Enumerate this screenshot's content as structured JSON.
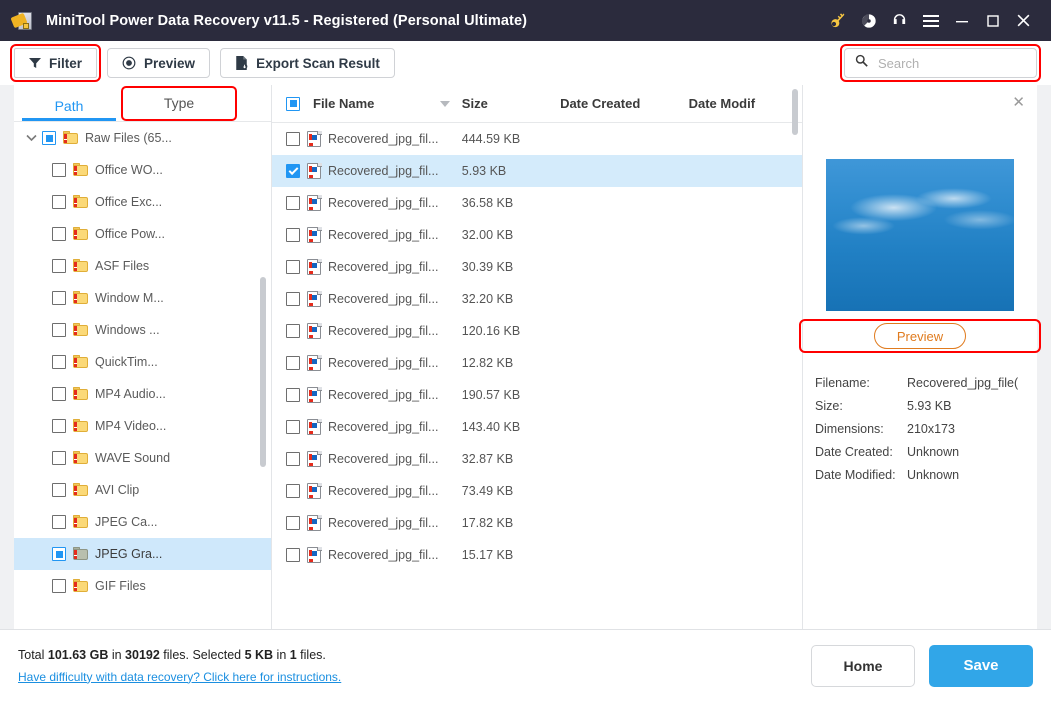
{
  "titlebar": {
    "title": "MiniTool Power Data Recovery v11.5 - Registered (Personal Ultimate)",
    "icons": [
      {
        "name": "key-icon",
        "label": "key"
      },
      {
        "name": "disc-icon",
        "label": "disc"
      },
      {
        "name": "headphones-icon",
        "label": "headphones"
      },
      {
        "name": "hamburger-menu-icon",
        "label": "menu"
      },
      {
        "name": "minimize-icon",
        "label": "minimize"
      },
      {
        "name": "maximize-icon",
        "label": "maximize"
      },
      {
        "name": "close-icon",
        "label": "close"
      }
    ]
  },
  "toolbar": {
    "filter_label": "Filter",
    "preview_label": "Preview",
    "export_label": "Export Scan Result"
  },
  "search": {
    "placeholder": "Search",
    "value": ""
  },
  "tabs": {
    "path_label": "Path",
    "type_label": "Type"
  },
  "tree": {
    "root": {
      "label": "Raw Files (65...",
      "check": "partial",
      "expanded": true
    },
    "items": [
      {
        "label": "Office WO...",
        "check": "none",
        "folder": "yellow"
      },
      {
        "label": "Office Exc...",
        "check": "none",
        "folder": "yellow"
      },
      {
        "label": "Office Pow...",
        "check": "none",
        "folder": "yellow"
      },
      {
        "label": "ASF Files",
        "check": "none",
        "folder": "yellow"
      },
      {
        "label": "Window M...",
        "check": "none",
        "folder": "yellow"
      },
      {
        "label": "Windows ...",
        "check": "none",
        "folder": "yellow"
      },
      {
        "label": "QuickTim...",
        "check": "none",
        "folder": "yellow"
      },
      {
        "label": "MP4 Audio...",
        "check": "none",
        "folder": "yellow"
      },
      {
        "label": "MP4 Video...",
        "check": "none",
        "folder": "yellow"
      },
      {
        "label": "WAVE Sound",
        "check": "none",
        "folder": "yellow"
      },
      {
        "label": "AVI Clip",
        "check": "none",
        "folder": "yellow"
      },
      {
        "label": "JPEG Ca...",
        "check": "none",
        "folder": "yellow"
      },
      {
        "label": "JPEG Gra...",
        "check": "partial",
        "folder": "gray",
        "selected": true
      },
      {
        "label": "GIF Files",
        "check": "none",
        "folder": "yellow"
      }
    ]
  },
  "filelist": {
    "columns": {
      "name": "File Name",
      "size": "Size",
      "date_created": "Date Created",
      "date_modified": "Date Modif"
    },
    "header_check": "partial",
    "rows": [
      {
        "name": "Recovered_jpg_fil...",
        "size": "444.59 KB",
        "checked": false,
        "selected": false
      },
      {
        "name": "Recovered_jpg_fil...",
        "size": "5.93 KB",
        "checked": true,
        "selected": true
      },
      {
        "name": "Recovered_jpg_fil...",
        "size": "36.58 KB",
        "checked": false,
        "selected": false
      },
      {
        "name": "Recovered_jpg_fil...",
        "size": "32.00 KB",
        "checked": false,
        "selected": false
      },
      {
        "name": "Recovered_jpg_fil...",
        "size": "30.39 KB",
        "checked": false,
        "selected": false
      },
      {
        "name": "Recovered_jpg_fil...",
        "size": "32.20 KB",
        "checked": false,
        "selected": false
      },
      {
        "name": "Recovered_jpg_fil...",
        "size": "120.16 KB",
        "checked": false,
        "selected": false
      },
      {
        "name": "Recovered_jpg_fil...",
        "size": "12.82 KB",
        "checked": false,
        "selected": false
      },
      {
        "name": "Recovered_jpg_fil...",
        "size": "190.57 KB",
        "checked": false,
        "selected": false
      },
      {
        "name": "Recovered_jpg_fil...",
        "size": "143.40 KB",
        "checked": false,
        "selected": false
      },
      {
        "name": "Recovered_jpg_fil...",
        "size": "32.87 KB",
        "checked": false,
        "selected": false
      },
      {
        "name": "Recovered_jpg_fil...",
        "size": "73.49 KB",
        "checked": false,
        "selected": false
      },
      {
        "name": "Recovered_jpg_fil...",
        "size": "17.82 KB",
        "checked": false,
        "selected": false
      },
      {
        "name": "Recovered_jpg_fil...",
        "size": "15.17 KB",
        "checked": false,
        "selected": false
      }
    ]
  },
  "preview": {
    "close_glyph": "✕",
    "button_label": "Preview",
    "meta": [
      {
        "key": "Filename:",
        "value": "Recovered_jpg_file("
      },
      {
        "key": "Size:",
        "value": "5.93 KB"
      },
      {
        "key": "Dimensions:",
        "value": "210x173"
      },
      {
        "key": "Date Created:",
        "value": "Unknown"
      },
      {
        "key": "Date Modified:",
        "value": "Unknown"
      }
    ]
  },
  "footer": {
    "total_prefix": "Total ",
    "total_size": "101.63 GB",
    "total_mid": " in ",
    "total_count": "30192",
    "total_suffix": " files.  Selected ",
    "selected_size": "5 KB",
    "selected_mid": " in ",
    "selected_count": "1",
    "selected_suffix": " files.",
    "help_link": "Have difficulty with data recovery? Click here for instructions.",
    "home_label": "Home",
    "save_label": "Save"
  },
  "colors": {
    "titlebar_bg": "#2b2b3d",
    "accent_blue": "#2196f3",
    "save_blue": "#31a6e8",
    "highlight_red": "#ff0000",
    "preview_orange": "#e07b1e",
    "row_selected": "#d4ebfb"
  }
}
